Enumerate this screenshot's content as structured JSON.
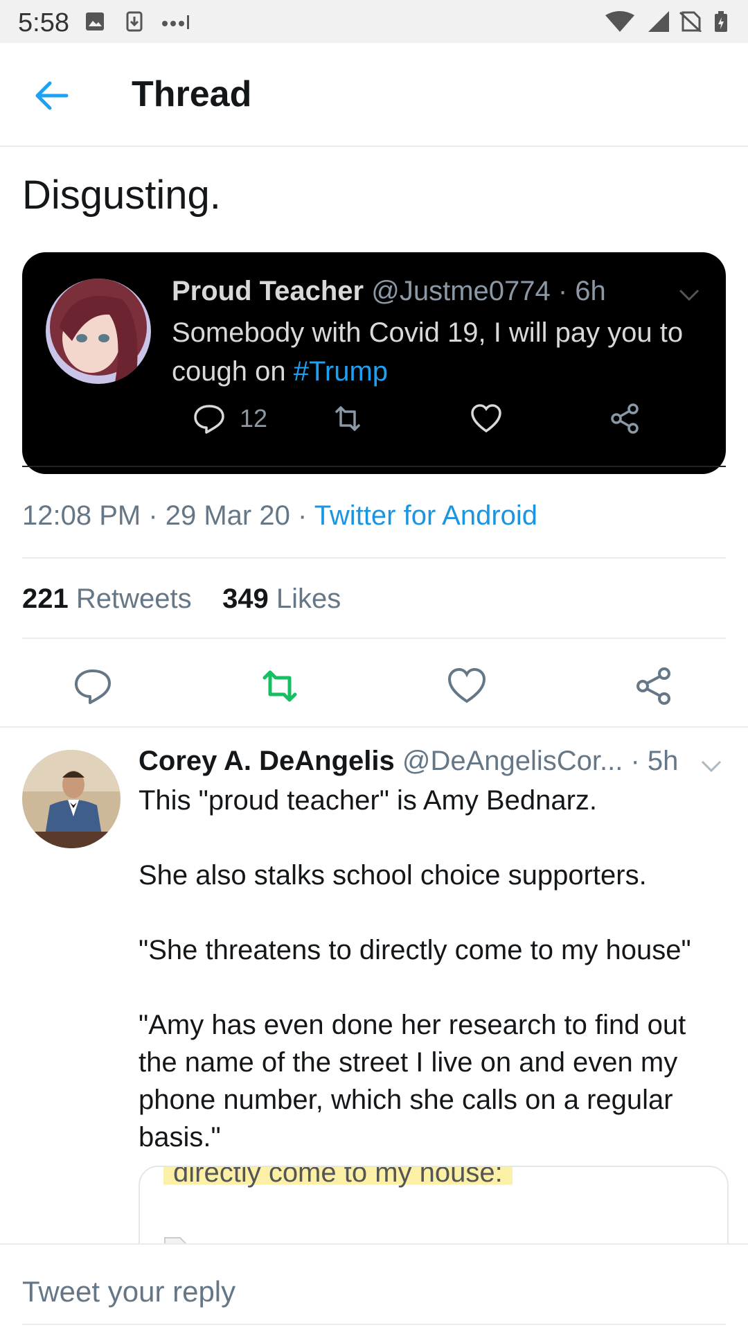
{
  "status_bar": {
    "time": "5:58"
  },
  "header": {
    "title": "Thread"
  },
  "tweet": {
    "text": "Disgusting.",
    "quoted": {
      "name": "Proud Teacher",
      "meta": " @Justme0774 · 6h",
      "text_before": "Somebody with Covid 19, I will pay you to cough on ",
      "hashtag": "#Trump",
      "reply_count": "12"
    },
    "timestamp": "12:08 PM · 29 Mar 20 · ",
    "source": "Twitter for Android",
    "retweets_count": "221",
    "retweets_label": " Retweets",
    "likes_count": "349",
    "likes_label": " Likes"
  },
  "reply": {
    "name": "Corey A. DeAngelis",
    "handle": " @DeAngelisCor... · 5h",
    "paragraphs": [
      "This \"proud teacher\" is Amy Bednarz.",
      "She also stalks school choice supporters.",
      "\"She threatens to directly come to my house\"",
      "\"Amy has even done her research to find out the name of the street I live on and even my phone number, which she calls on a regular basis.\""
    ],
    "embed_text": "directly come to my house:"
  },
  "reply_bar": {
    "placeholder": "Tweet your reply"
  },
  "colors": {
    "accent": "#1da1f2",
    "retweet_active": "#17bf63",
    "muted": "#657786"
  }
}
